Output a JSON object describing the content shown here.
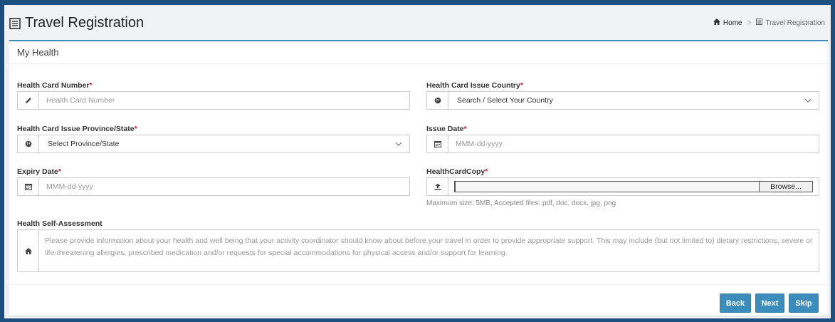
{
  "header": {
    "title": "Travel Registration",
    "breadcrumb": [
      {
        "label": "Home",
        "icon": "home-icon"
      },
      {
        "label": "Travel Registration",
        "icon": "list-icon"
      }
    ]
  },
  "card": {
    "title": "My Health"
  },
  "form": {
    "health_card_number": {
      "label": "Health Card Number",
      "required_mark": "*",
      "placeholder": "Health Card Number",
      "value": "",
      "icon": "pencil-icon"
    },
    "health_card_issue_country": {
      "label": "Health Card Issue Country",
      "required_mark": "*",
      "selected": "Search / Select Your Country",
      "icon": "globe-icon"
    },
    "health_card_issue_province": {
      "label": "Health Card Issue Province/State",
      "required_mark": "*",
      "selected": "Select Province/State",
      "icon": "globe-icon"
    },
    "issue_date": {
      "label": "Issue Date",
      "required_mark": "*",
      "placeholder": "MMM-dd-yyyy",
      "value": "",
      "icon": "calendar-icon"
    },
    "expiry_date": {
      "label": "Expiry Date",
      "required_mark": "*",
      "placeholder": "MMM-dd-yyyy",
      "value": "",
      "icon": "calendar-icon"
    },
    "health_card_copy": {
      "label": "HealthCardCopy",
      "required_mark": "*",
      "browse_label": "Browse...",
      "help": "Maximum size: 5MB, Accepted files: pdf, doc, docx, jpg, png",
      "icon": "upload-icon"
    },
    "self_assessment": {
      "label": "Health Self-Assessment",
      "placeholder": "Please provide information about your health and well being that your activity coordinator should know about before your travel in order to provide appropriate support. This may include (but not limited to) dietary restrictions, severe or life-threatening allergies, prescribed medication and/or requests for special accommodations for physical access and/or support for learning.",
      "icon": "home-icon"
    }
  },
  "footer": {
    "back_label": "Back",
    "next_label": "Next",
    "skip_label": "Skip"
  },
  "colors": {
    "accent": "#3c8dbc",
    "required": "#dd1144",
    "frame": "#1c4e80"
  }
}
